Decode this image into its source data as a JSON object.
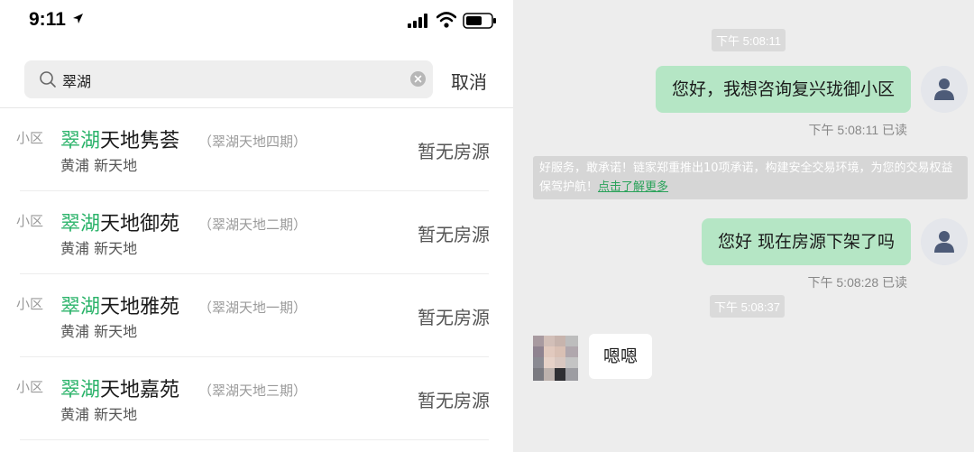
{
  "status_bar": {
    "time": "9:11"
  },
  "search": {
    "query": "翠湖",
    "cancel_label": "取消"
  },
  "results": [
    {
      "category": "小区",
      "name_highlight": "翠湖",
      "name_rest": "天地隽荟",
      "alias": "（翠湖天地四期）",
      "district": "黄浦 新天地",
      "status": "暂无房源"
    },
    {
      "category": "小区",
      "name_highlight": "翠湖",
      "name_rest": "天地御苑",
      "alias": "（翠湖天地二期）",
      "district": "黄浦 新天地",
      "status": "暂无房源"
    },
    {
      "category": "小区",
      "name_highlight": "翠湖",
      "name_rest": "天地雅苑",
      "alias": "（翠湖天地一期）",
      "district": "黄浦 新天地",
      "status": "暂无房源"
    },
    {
      "category": "小区",
      "name_highlight": "翠湖",
      "name_rest": "天地嘉苑",
      "alias": "（翠湖天地三期）",
      "district": "黄浦 新天地",
      "status": "暂无房源"
    }
  ],
  "chat": {
    "time_1": "下午 5:08:11",
    "msg_1": "您好，我想咨询复兴珑御小区",
    "read_1": "下午 5:08:11 已读",
    "notice_text": "好服务，敢承诺！链家郑重推出10项承诺，构建安全交易环境，为您的交易权益保驾护航！",
    "notice_link": "点击了解更多",
    "msg_2": "您好 现在房源下架了吗",
    "read_2": "下午 5:08:28 已读",
    "time_2": "下午 5:08:37",
    "reply_1": "嗯嗯"
  },
  "colors": {
    "highlight_green": "#2bb36a",
    "bubble_green": "#b5e6c5",
    "chat_bg": "#ededed"
  }
}
